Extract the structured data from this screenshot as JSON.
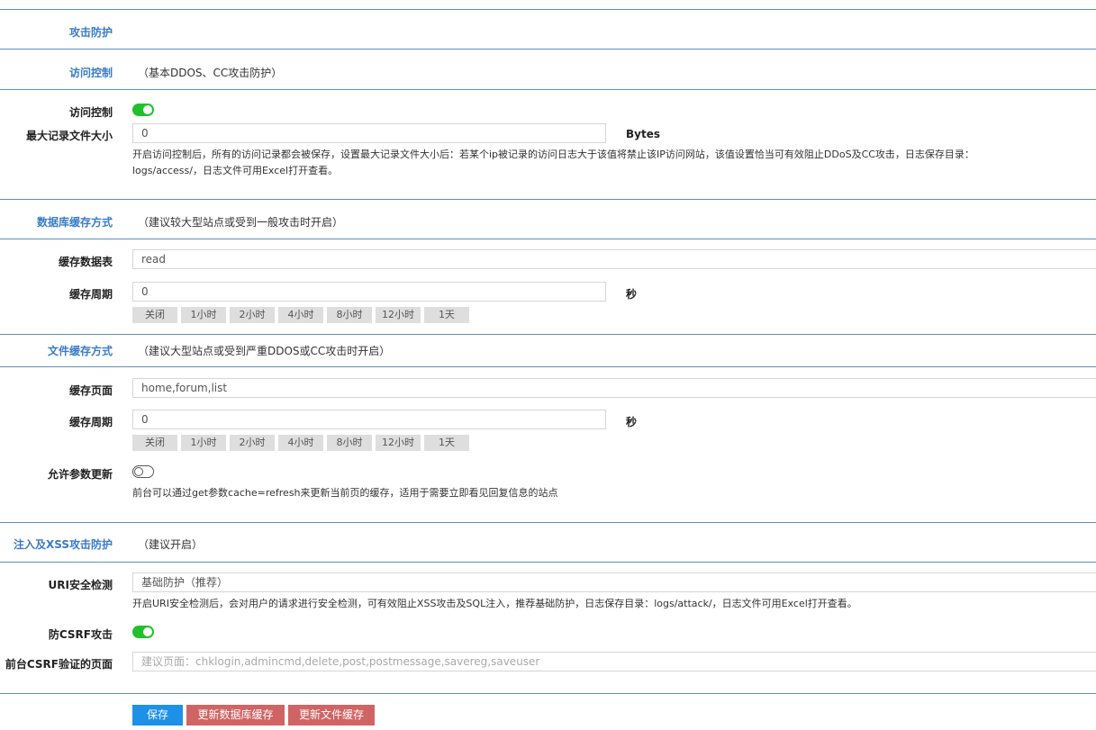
{
  "sections": {
    "attack": {
      "title": "攻击防护"
    },
    "access": {
      "title": "访问控制",
      "note": "（基本DDOS、CC攻击防护）",
      "toggle_label": "访问控制",
      "toggle_on": true,
      "max_size_label": "最大记录文件大小",
      "max_size_value": "0",
      "max_size_unit": "Bytes",
      "help_line1": "开启访问控制后，所有的访问记录都会被保存，设置最大记录文件大小后：若某个ip被记录的访问日志大于该值将禁止该IP访问网站，该值设置恰当可有效阻止DDoS及CC攻击，日志保存目录：",
      "help_line2": "logs/access/，日志文件可用Excel打开查看。"
    },
    "db_cache": {
      "title": "数据库缓存方式",
      "note": "（建议较大型站点或受到一般攻击时开启）",
      "table_label": "缓存数据表",
      "table_value": "read",
      "period_label": "缓存周期",
      "period_value": "0",
      "period_unit": "秒"
    },
    "file_cache": {
      "title": "文件缓存方式",
      "note": "（建议大型站点或受到严重DDOS或CC攻击时开启）",
      "pages_label": "缓存页面",
      "pages_value": "home,forum,list",
      "period_label": "缓存周期",
      "period_value": "0",
      "period_unit": "秒",
      "param_label": "允许参数更新",
      "param_on": false,
      "param_help": "前台可以通过get参数cache=refresh来更新当前页的缓存，适用于需要立即看见回复信息的站点"
    },
    "xss": {
      "title": "注入及XSS攻击防护",
      "note": "（建议开启）",
      "uri_label": "URI安全检测",
      "uri_value": "基础防护（推荐）",
      "uri_help": "开启URI安全检测后，会对用户的请求进行安全检测，可有效阻止XSS攻击及SQL注入，推荐基础防护，日志保存目录：logs/attack/，日志文件可用Excel打开查看。",
      "csrf_label": "防CSRF攻击",
      "csrf_on": true,
      "csrf_pages_label": "前台CSRF验证的页面",
      "csrf_pages_placeholder": "建议页面：chklogin,admincmd,delete,post,postmessage,savereg,saveuser"
    }
  },
  "period_options": [
    "关闭",
    "1小时",
    "2小时",
    "4小时",
    "8小时",
    "12小时",
    "1天"
  ],
  "buttons": {
    "save": "保存",
    "update_db": "更新数据库缓存",
    "update_file": "更新文件缓存"
  },
  "colors": {
    "accent": "#3a7bc8",
    "toggle_on": "#21c12b",
    "btn_primary": "#1e90e8",
    "btn_danger": "#d06464"
  }
}
